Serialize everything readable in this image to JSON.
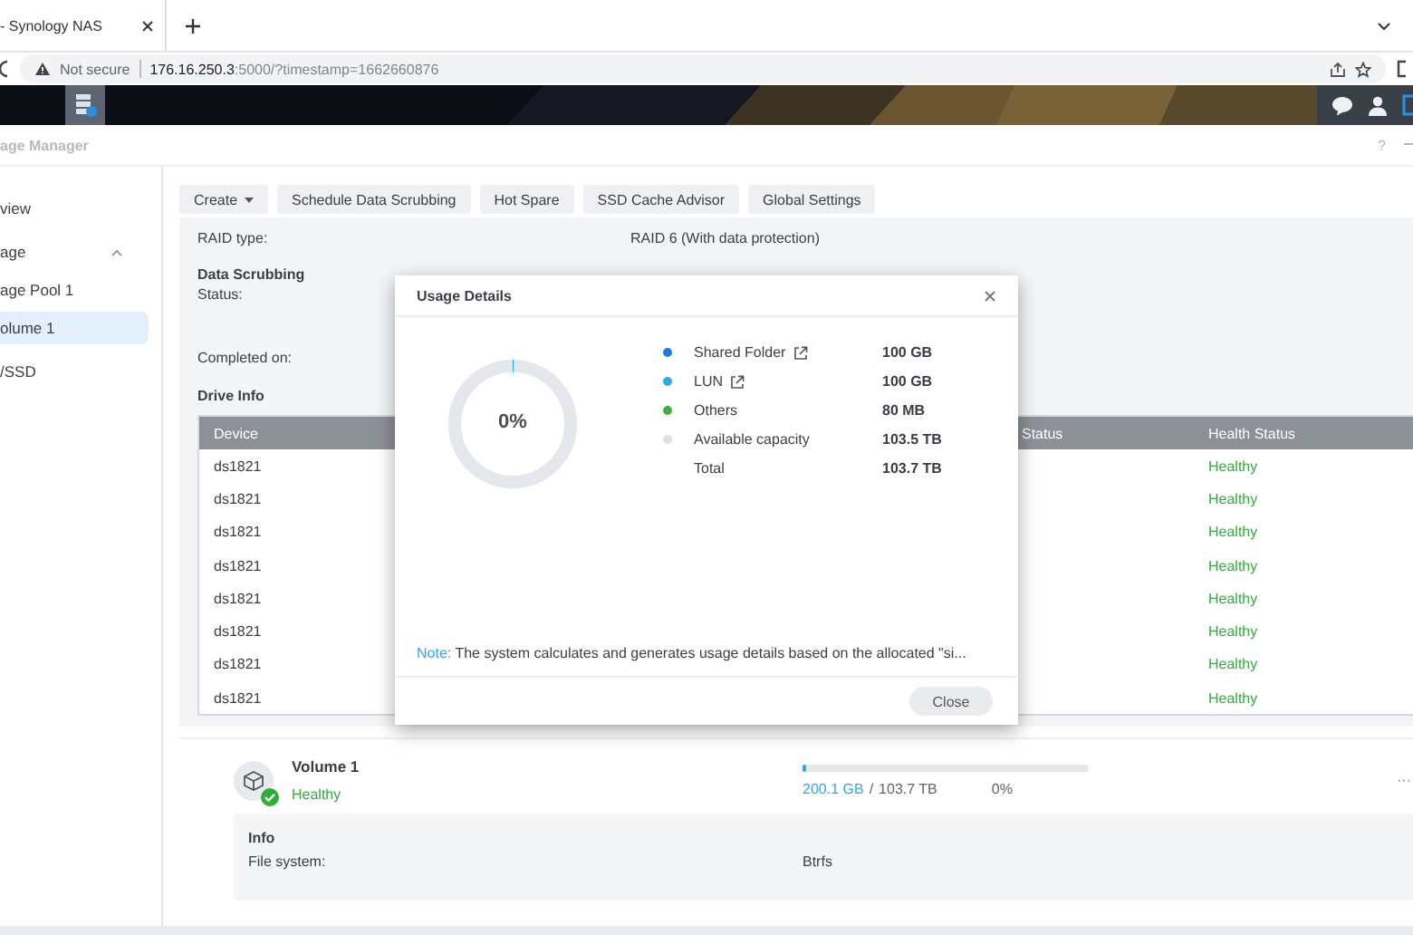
{
  "browser": {
    "tab_title": "- Synology NAS",
    "security": "Not secure",
    "url_host": "176.16.250.3",
    "url_rest": ":5000/?timestamp=1662660876"
  },
  "window": {
    "title": "age Manager",
    "help": "?"
  },
  "sidebar": {
    "items": [
      {
        "label": "view",
        "selected": false
      },
      {
        "label": "age",
        "selected": false,
        "expanded": true,
        "children": [
          {
            "label": "age Pool 1",
            "selected": false
          },
          {
            "label": "olume 1",
            "selected": true
          }
        ]
      },
      {
        "label": "/SSD",
        "selected": false
      }
    ]
  },
  "toolbar": {
    "buttons": [
      {
        "label": "Create",
        "kind": "menu"
      },
      {
        "label": "Schedule Data Scrubbing",
        "kind": "button"
      },
      {
        "label": "Hot Spare",
        "kind": "button"
      },
      {
        "label": "SSD Cache Advisor",
        "kind": "button"
      },
      {
        "label": "Global Settings",
        "kind": "button"
      }
    ]
  },
  "details": {
    "raid": {
      "label": "RAID type:",
      "value": "RAID 6 (With data protection)"
    },
    "data_scrubbing": {
      "title": "Data Scrubbing",
      "fields": [
        "Status:",
        "Completed on:"
      ]
    },
    "drive_info": {
      "title": "Drive Info",
      "columns": [
        "Device",
        "Status",
        "Health Status"
      ],
      "rows": [
        {
          "device": "ds1821",
          "health": "Healthy"
        },
        {
          "device": "ds1821",
          "health": "Healthy"
        },
        {
          "device": "ds1821",
          "health": "Healthy"
        },
        {
          "device": "ds1821",
          "health": "Healthy"
        },
        {
          "device": "ds1821",
          "health": "Healthy"
        },
        {
          "device": "ds1821",
          "health": "Healthy"
        },
        {
          "device": "ds1821",
          "health": "Healthy"
        },
        {
          "device": "ds1821",
          "health": "Healthy"
        }
      ]
    }
  },
  "volume": {
    "name": "Volume 1",
    "status": "Healthy",
    "level": 0.002,
    "used": "200.1 GB",
    "separator": "/",
    "total": "103.7 TB",
    "percent": "0%",
    "more": "···",
    "info": {
      "title": "Info",
      "fields": [
        {
          "label": "File system:",
          "value": "Btrfs"
        }
      ]
    }
  },
  "modal": {
    "title": "Usage Details",
    "donut": {
      "level": 0.002,
      "label": "0%"
    },
    "legend": [
      {
        "label": "Shared Folder",
        "value": "100 GB",
        "color": "#1a7be0",
        "linked": true
      },
      {
        "label": "LUN",
        "value": "100 GB",
        "color": "#2fa8e8",
        "linked": true
      },
      {
        "label": "Others",
        "value": "80 MB",
        "color": "#3cb043"
      },
      {
        "label": "Available capacity",
        "value": "103.5 TB",
        "color": "#dde1e6"
      },
      {
        "label": "Total",
        "value": "103.7 TB"
      }
    ],
    "note_label": "Note:",
    "note": "The system calculates and generates usage details based on the allocated \"si...",
    "buttons": [
      "Close"
    ]
  }
}
